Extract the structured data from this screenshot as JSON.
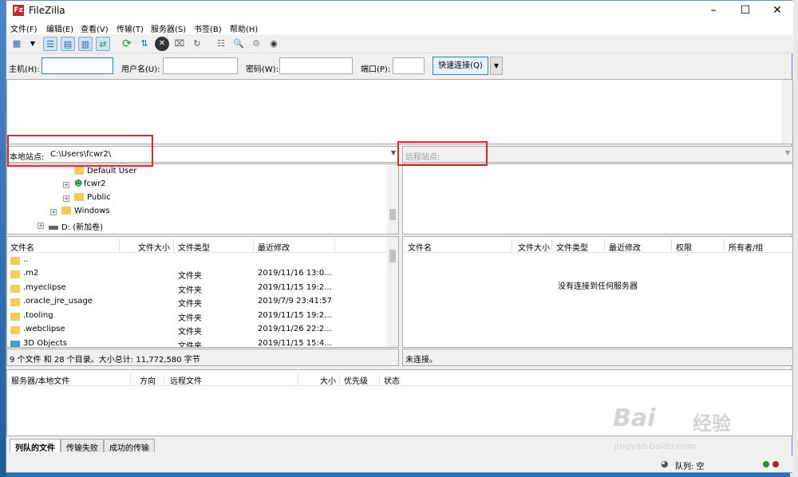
{
  "window": {
    "title": "FileZilla",
    "app_icon": "Fz"
  },
  "menu": [
    "文件(F)",
    "编辑(E)",
    "查看(V)",
    "传输(T)",
    "服务器(S)",
    "书签(B)",
    "帮助(H)"
  ],
  "toolbar_icons": [
    "site-manager-icon",
    "dropdown-icon",
    "toggle-log-icon",
    "toggle-local-tree-icon",
    "toggle-remote-tree-icon",
    "toggle-queue-icon",
    "refresh-icon",
    "process-queue-icon",
    "cancel-icon",
    "disconnect-icon",
    "reconnect-icon",
    "filter-icon",
    "compare-icon",
    "sync-browse-icon",
    "search-icon"
  ],
  "quickconnect": {
    "host_label": "主机(H):",
    "host_value": "",
    "user_label": "用户名(U):",
    "user_value": "",
    "pass_label": "密码(W):",
    "pass_value": "",
    "port_label": "端口(P):",
    "port_value": "",
    "button": "快速连接(Q)"
  },
  "local": {
    "site_label": "本地站点:",
    "path": "C:\\Users\\fcwr2\\",
    "tree": [
      "Default User",
      "fcwr2",
      "Public",
      "Windows",
      "D: (新加卷)"
    ],
    "columns": [
      "文件名",
      "文件大小",
      "文件类型",
      "最近修改"
    ],
    "rows": [
      {
        "name": "..",
        "size": "",
        "type": "",
        "modified": ""
      },
      {
        "name": ".m2",
        "size": "",
        "type": "文件夹",
        "modified": "2019/11/16 13:0..."
      },
      {
        "name": ".myeclipse",
        "size": "",
        "type": "文件夹",
        "modified": "2019/11/15 19:2..."
      },
      {
        "name": ".oracle_jre_usage",
        "size": "",
        "type": "文件夹",
        "modified": "2019/7/9 23:41:57"
      },
      {
        "name": ".tooling",
        "size": "",
        "type": "文件夹",
        "modified": "2019/11/15 19:2..."
      },
      {
        "name": ".webclipse",
        "size": "",
        "type": "文件夹",
        "modified": "2019/11/26 22:2..."
      },
      {
        "name": "3D Objects",
        "size": "",
        "type": "文件夹",
        "modified": "2019/11/15 15:4..."
      }
    ],
    "status": "9 个文件 和 28 个目录。大小总计: 11,772,580 字节"
  },
  "remote": {
    "site_label": "远程站点:",
    "path": "",
    "columns": [
      "文件名",
      "文件大小",
      "文件类型",
      "最近修改",
      "权限",
      "所有者/组"
    ],
    "empty_message": "没有连接到任何服务器",
    "status": "未连接。"
  },
  "queue": {
    "columns": [
      "服务器/本地文件",
      "方向",
      "远程文件",
      "大小",
      "优先级",
      "状态"
    ]
  },
  "tabs": [
    "列队的文件",
    "传输失败",
    "成功的传输"
  ],
  "bottom": {
    "queue_status": "队列: 空"
  },
  "watermark": {
    "brand": "Bai",
    "brand2": "经验",
    "url": "jingyan.baidu.com"
  },
  "colors": {
    "highlight": "#e0262b",
    "folder": "#f4cc5a",
    "button_border": "#3c7fb1"
  }
}
